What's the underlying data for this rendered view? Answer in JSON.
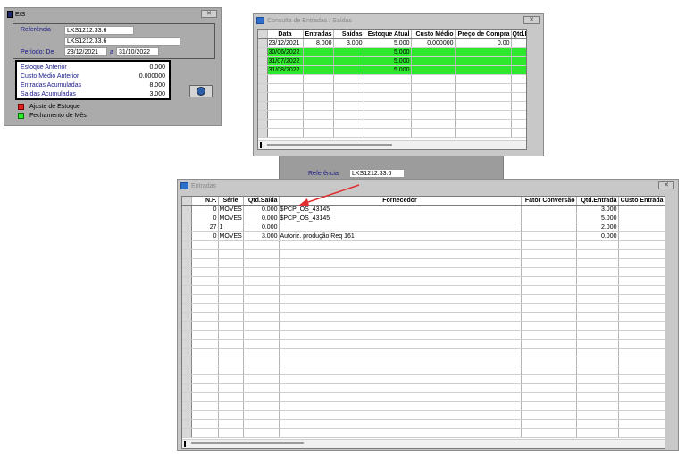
{
  "es": {
    "title": "E/S",
    "close": "✕",
    "referencia_label": "Referência",
    "referencia_value": "LKS1212.33.6",
    "referencia_value2": "LKS1212.33.6",
    "periodo_label": "Período: De",
    "periodo_de": "23/12/2021",
    "periodo_a_label": "a",
    "periodo_ate": "31/10/2022",
    "summary": [
      {
        "label": "Estoque Anterior",
        "value": "0.000"
      },
      {
        "label": "Custo Médio Anterior",
        "value": "0.000000"
      },
      {
        "label": "Entradas Acumuladas",
        "value": "8.000"
      },
      {
        "label": "Saídas Acumuladas",
        "value": "3.000"
      }
    ],
    "legend": [
      {
        "label": "Ajuste de Estoque",
        "color": "#e02020"
      },
      {
        "label": "Fechamento de Mês",
        "color": "#2ee82e"
      }
    ]
  },
  "consulta": {
    "title": "Consulta de Entradas / Saídas",
    "close": "✕",
    "columns": [
      "Data",
      "Entradas",
      "Saídas",
      "Estoque Atual",
      "Custo Médio",
      "Preço de Compra",
      "Qtd.E"
    ],
    "rows": [
      [
        "23/12/2021",
        "8.000",
        "3.000",
        "5.000",
        "0.000000",
        "0.00",
        ""
      ],
      [
        "30/06/2022",
        "",
        "",
        "5.000",
        "",
        "",
        ""
      ],
      [
        "31/07/2022",
        "",
        "",
        "5.000",
        "",
        "",
        ""
      ],
      [
        "31/08/2022",
        "",
        "",
        "5.000",
        "",
        "",
        ""
      ]
    ]
  },
  "middle": {
    "referencia_label": "Referência",
    "referencia_value": "LKS1212.33.6"
  },
  "entradas": {
    "title": "Entradas",
    "close": "✕",
    "columns": [
      "N.F.",
      "Série",
      "Qtd.Saída",
      "Fornecedor",
      "Fator Conversão",
      "Qtd.Entrada",
      "Custo Entrada"
    ],
    "rows": [
      [
        "0",
        "MOVES",
        "0.000",
        "$PCP_OS_43145",
        "",
        "3.000",
        ""
      ],
      [
        "0",
        "MOVES",
        "0.000",
        "$PCP_OS_43145",
        "",
        "5.000",
        ""
      ],
      [
        "27",
        "1",
        "0.000",
        "",
        "",
        "2.000",
        ""
      ],
      [
        "0",
        "MOVES",
        "3.000",
        "Autoriz. produção Req 161",
        "",
        "0.000",
        ""
      ]
    ]
  },
  "colors": {
    "window_bg": "#ababab",
    "highlight_green": "#2ee82e",
    "arrow_red": "#e23030"
  }
}
